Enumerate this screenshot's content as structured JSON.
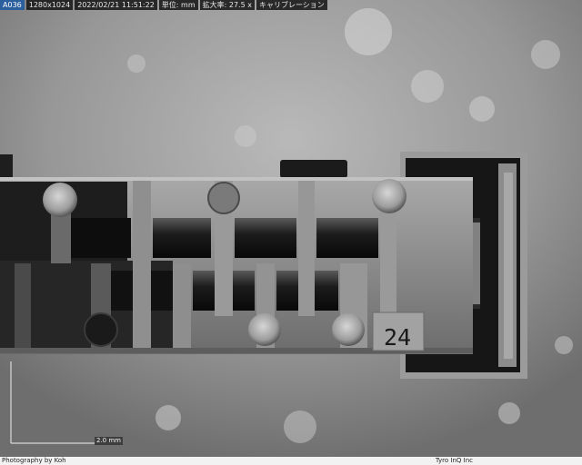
{
  "hud": {
    "camera_id": "A036",
    "resolution": "1280x1024",
    "datetime": "2022/02/21 11:51:22",
    "unit": "単位: mm",
    "magnification_label": "拡大率: 27.5 x",
    "mode_label": "キャリブレーション"
  },
  "part_label": "24",
  "scale_bar": {
    "label": "2.0 mm"
  },
  "footer": {
    "credit": "Photography by Koh",
    "company": "Tyro InQ Inc"
  },
  "colors": {
    "background": "#9a9a9a",
    "metal": "#8c8c8c",
    "dark_plastic": "#151515",
    "hud_bg": "#141414",
    "hud_accent": "#2b5f9e"
  }
}
